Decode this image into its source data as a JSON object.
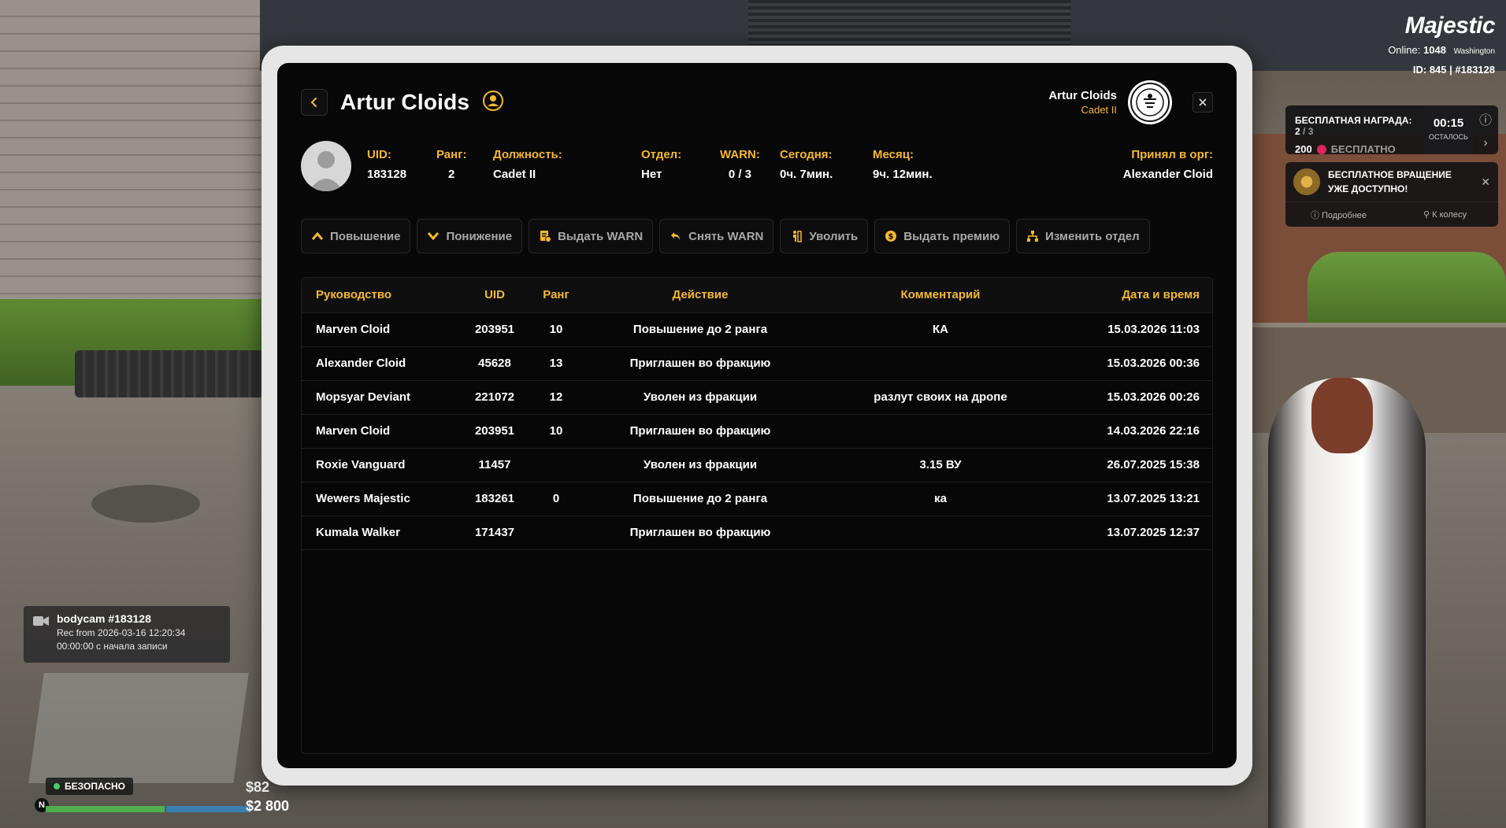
{
  "header": {
    "title": "Artur Cloids",
    "user_name": "Artur Cloids",
    "user_rank": "Cadet II"
  },
  "info": {
    "uid_label": "UID:",
    "uid_value": "183128",
    "rank_label": "Ранг:",
    "rank_value": "2",
    "position_label": "Должность:",
    "position_value": "Cadet II",
    "department_label": "Отдел:",
    "department_value": "Нет",
    "warn_label": "WARN:",
    "warn_value": "0 / 3",
    "today_label": "Сегодня:",
    "today_value": "0ч. 7мин.",
    "month_label": "Месяц:",
    "month_value": "9ч. 12мин.",
    "hired_label": "Принял в орг:",
    "hired_value": "Alexander Cloid"
  },
  "actions": {
    "promote": "Повышение",
    "demote": "Понижение",
    "give_warn": "Выдать WARN",
    "remove_warn": "Снять WARN",
    "fire": "Уволить",
    "give_bonus": "Выдать премию",
    "change_department": "Изменить отдел"
  },
  "table": {
    "headers": [
      "Руководство",
      "UID",
      "Ранг",
      "Действие",
      "Комментарий",
      "Дата и время"
    ],
    "rows": [
      [
        "Marven Cloid",
        "203951",
        "10",
        "Повышение до 2 ранга",
        "КА",
        "15.03.2026 11:03"
      ],
      [
        "Alexander Cloid",
        "45628",
        "13",
        "Приглашен во фракцию",
        "",
        "15.03.2026 00:36"
      ],
      [
        "Mopsyar Deviant",
        "221072",
        "12",
        "Уволен из фракции",
        "разлут своих на дропе",
        "15.03.2026 00:26"
      ],
      [
        "Marven Cloid",
        "203951",
        "10",
        "Приглашен во фракцию",
        "",
        "14.03.2026 22:16"
      ],
      [
        "Roxie Vanguard",
        "11457",
        "",
        "Уволен из фракции",
        "3.15 ВУ",
        "26.07.2025 15:38"
      ],
      [
        "Wewers Majestic",
        "183261",
        "0",
        "Повышение до 2 ранга",
        "ка",
        "13.07.2025 13:21"
      ],
      [
        "Kumala Walker",
        "171437",
        "",
        "Приглашен во фракцию",
        "",
        "13.07.2025 12:37"
      ]
    ]
  },
  "hud": {
    "brand": "Majestic",
    "online_label": "Online:",
    "online_value": "1048",
    "city": "Washington",
    "id_line": "ID: 845 | #183128",
    "reward_title": "БЕСПЛАТНАЯ НАГРАДА: 2",
    "reward_total": "/ 3",
    "reward_amount": "200",
    "reward_free": "БЕСПЛАТНО",
    "timer": "00:15",
    "timer_label": "ОСТАЛОСЬ",
    "spin_line1": "БЕСПЛАТНОЕ ВРАЩЕНИЕ",
    "spin_line2": "УЖЕ ДОСТУПНО!",
    "spin_more": "Подробнее",
    "spin_wheel": "К колесу",
    "bodycam_title": "bodycam #183128",
    "bodycam_rec": "Rec from 2026-03-16 12:20:34",
    "bodycam_elapsed": "00:00:00 с начала записи",
    "safe": "БЕЗОПАСНО",
    "compass": "N",
    "money1": "$82",
    "money2": "$2 800"
  },
  "colors": {
    "accent": "#f5b82e",
    "background": "#080808",
    "panel_border": "#1e1e1e"
  }
}
